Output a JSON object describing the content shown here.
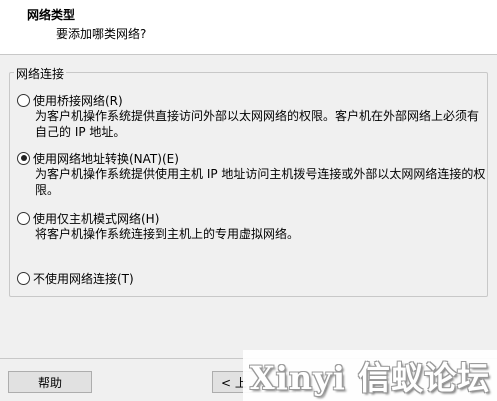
{
  "header": {
    "title": "网络类型",
    "subtitle": "要添加哪类网络?"
  },
  "group": {
    "label": "网络连接"
  },
  "options": [
    {
      "label": "使用桥接网络(R)",
      "description": "为客户机操作系统提供直接访问外部以太网网络的权限。客户机在外部网络上必须有自己的 IP 地址。",
      "checked": false
    },
    {
      "label": "使用网络地址转换(NAT)(E)",
      "description": "为客户机操作系统提供使用主机 IP 地址访问主机拨号连接或外部以太网网络连接的权限。",
      "checked": true
    },
    {
      "label": "使用仅主机模式网络(H)",
      "description": "将客户机操作系统连接到主机上的专用虚拟网络。",
      "checked": false
    },
    {
      "label": "不使用网络连接(T)",
      "description": "",
      "checked": false
    }
  ],
  "buttons": {
    "help": "帮助",
    "back": "< 上"
  },
  "watermark": "Xinyi 信蚁论坛"
}
